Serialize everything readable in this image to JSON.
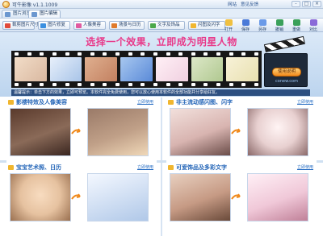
{
  "app": {
    "title": "可牛影像 v1.1.1009",
    "links": [
      "网站",
      "意见反馈"
    ],
    "win_buttons": [
      "-",
      "□",
      "×"
    ]
  },
  "tabs": [
    {
      "label": "图片浏览",
      "active": false,
      "icon": "folder-icon"
    },
    {
      "label": "图片编辑",
      "active": true,
      "icon": "image-edit-icon"
    }
  ],
  "toolbar": {
    "left_tools": [
      {
        "label": "裁剪图片尺寸",
        "icon": "crop-icon",
        "color": "#e04a3a"
      },
      {
        "label": "图片修复",
        "icon": "repair-icon",
        "color": "#3a8fe0"
      },
      {
        "label": "人像美容",
        "icon": "beauty-icon",
        "color": "#e05aa0"
      },
      {
        "label": "场景与日历",
        "icon": "calendar-icon",
        "color": "#e07a2a"
      },
      {
        "label": "文字及饰品",
        "icon": "text-icon",
        "color": "#4aa84a"
      },
      {
        "label": "闪图及闪字",
        "icon": "flash-icon",
        "color": "#f0b62f"
      }
    ],
    "right_tools": [
      {
        "label": "打开",
        "icon": "open-icon",
        "color": "#f0c040"
      },
      {
        "label": "保存",
        "icon": "save-icon",
        "color": "#4a7ad8"
      },
      {
        "label": "另存",
        "icon": "save-as-icon",
        "color": "#6a9ae8"
      },
      {
        "label": "撤销",
        "icon": "undo-icon",
        "color": "#3aa05a"
      },
      {
        "label": "重做",
        "icon": "redo-icon",
        "color": "#3aa05a"
      },
      {
        "label": "对比",
        "icon": "compare-icon",
        "color": "#8a6ad8"
      }
    ]
  },
  "banner": {
    "headline": "选择一个效果，立即成为明星人物",
    "frames": [
      "#d9b8a0",
      "#a8c4e8",
      "#c28060",
      "#5a8ad8",
      "#f0d0e0",
      "#b0c890",
      "#e8e0b0"
    ],
    "clapper_button": "使用说明",
    "clapper_site": "conew.com",
    "tip": "温馨提示：单击下方的效果，立即可预览。本软件完全免费使用，您可以放心使用本软件的全部功能并分享给好友。"
  },
  "panels": [
    {
      "title": "影楼特效及人像美容",
      "link": "立即使用",
      "before": "#8a6a58",
      "after": "#c0a088"
    },
    {
      "title": "非主流动感闪图、闪字",
      "link": "立即使用",
      "before": "#d8b4b0",
      "after": "#e8d0d0"
    },
    {
      "title": "宝宝艺术照、日历",
      "link": "立即使用",
      "before": "#e6c2a0",
      "after": "#b0c8e8"
    },
    {
      "title": "可爱饰品及多彩文字",
      "link": "立即使用",
      "before": "#c69a84",
      "after": "#f0c8d8"
    }
  ]
}
